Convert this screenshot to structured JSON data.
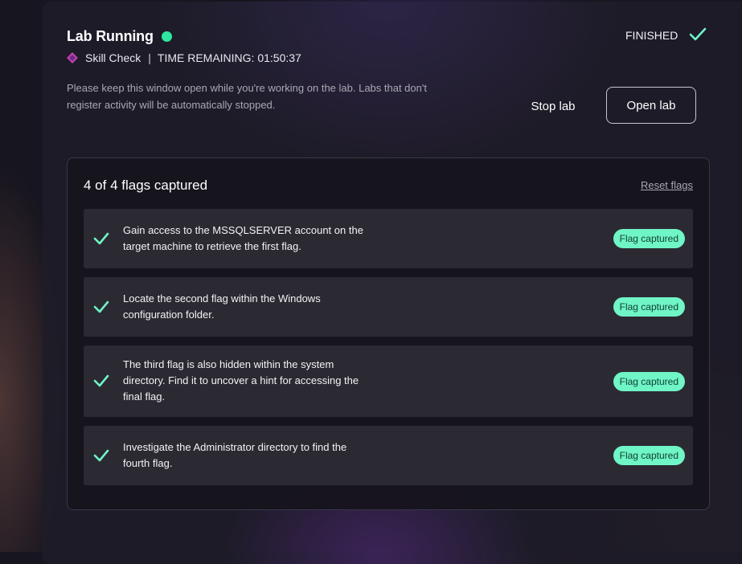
{
  "header": {
    "title": "Lab Running",
    "status_color": "#2ee6a0",
    "category": "Skill Check",
    "separator": "|",
    "time_remaining": "TIME REMAINING: 01:50:37",
    "notice": "Please keep this window open while you're working on the lab. Labs that don't register activity will be automatically stopped.",
    "finished_label": "FINISHED"
  },
  "actions": {
    "stop_label": "Stop lab",
    "open_label": "Open lab"
  },
  "flags": {
    "summary": "4 of 4 flags captured",
    "reset_label": "Reset flags",
    "badge_color": "#6ff5c6",
    "check_color": "#6ff5c6",
    "items": [
      {
        "text": "Gain access to the MSSQLSERVER account on the target machine to retrieve the first flag.",
        "status": "Flag captured"
      },
      {
        "text": "Locate the second flag within the Windows configuration folder.",
        "status": "Flag captured"
      },
      {
        "text": "The third flag is also hidden within the system directory. Find it to uncover a hint for accessing the final flag.",
        "status": "Flag captured"
      },
      {
        "text": "Investigate the Administrator directory to find the fourth flag.",
        "status": "Flag captured"
      }
    ]
  }
}
